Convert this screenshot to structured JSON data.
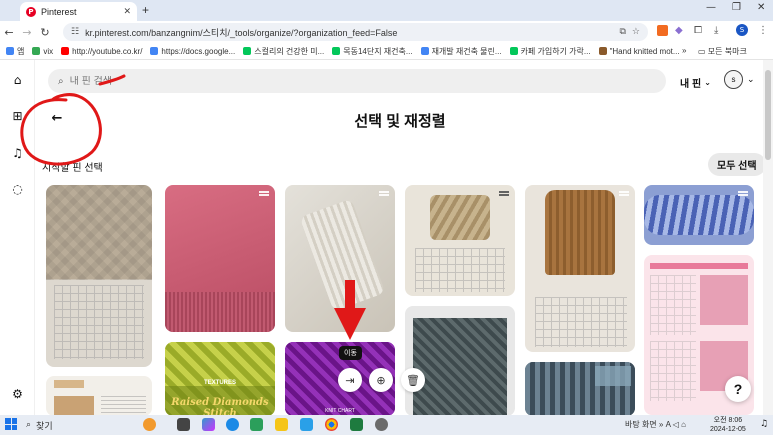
{
  "browser": {
    "tab_title": "Pinterest",
    "tab_favicon": "P",
    "new_tab": "+",
    "window_controls": [
      "—",
      "❐",
      "✕"
    ],
    "url": "kr.pinterest.com/banzangnim/스티치/_tools/organize/?organization_feed=False",
    "profile_initial": "S",
    "bookmarks": [
      {
        "label": "앱",
        "color": "#4285f4"
      },
      {
        "label": "vix",
        "color": "#34a853"
      },
      {
        "label": "http://youtube.co.kr/",
        "color": "#ff0000"
      },
      {
        "label": "https://docs.google...",
        "color": "#4285f4"
      },
      {
        "label": "스컬리의 건강한 미...",
        "color": "#03c75a"
      },
      {
        "label": "목동14단지 재건축...",
        "color": "#03c75a"
      },
      {
        "label": "재개발 재건축 물린...",
        "color": "#4285f4"
      },
      {
        "label": "카페 가입하기 가락...",
        "color": "#03c75a"
      },
      {
        "label": "\"Hand knitted mot...",
        "color": "#8a5a2b"
      }
    ],
    "bookmarks_more": "»",
    "bookmarks_folder": "모든 북마크"
  },
  "header": {
    "search_placeholder": "내 핀 검색",
    "my_pins_label": "내 핀",
    "avatar_initial": "s"
  },
  "page": {
    "title": "선택 및 재정렬",
    "subtitle": "시작할 핀 선택",
    "select_all": "모두 선택",
    "help": "?"
  },
  "pins": {
    "raised_top": "TEXTURES",
    "raised_title": "Raised Diamonds Stitch",
    "chart_label": "KNIT CHART"
  },
  "hover": {
    "tooltip": "이동",
    "move_icon": "move-icon",
    "add_icon": "add-to-section-icon",
    "delete_icon": "trash-icon"
  },
  "taskbar": {
    "search": "찾기",
    "tray": "바탕 화면",
    "ime": "A",
    "time": "오전 8:06",
    "date": "2024-12-05"
  },
  "colors": {
    "pinterest_red": "#e60023",
    "annotation_red": "#e01818"
  }
}
